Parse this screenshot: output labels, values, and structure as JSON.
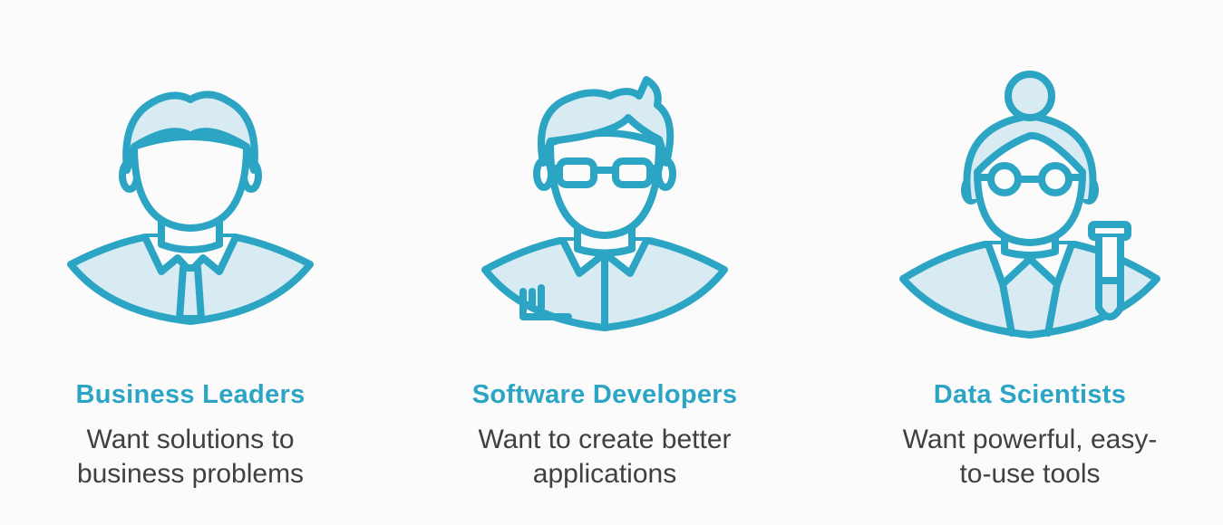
{
  "colors": {
    "accent": "#2ca5c4",
    "accent_fill": "#d8ebf3",
    "text": "#404040",
    "background": "#fbfbfb"
  },
  "personas": [
    {
      "icon": "business-leader-icon",
      "title": "Business Leaders",
      "description_lines": [
        "Want solutions to",
        "business problems"
      ]
    },
    {
      "icon": "software-developer-icon",
      "title": "Software Developers",
      "description_lines": [
        "Want to create better",
        "applications"
      ]
    },
    {
      "icon": "data-scientist-icon",
      "title": "Data Scientists",
      "description_lines": [
        "Want powerful, easy-",
        "to-use tools"
      ]
    }
  ]
}
